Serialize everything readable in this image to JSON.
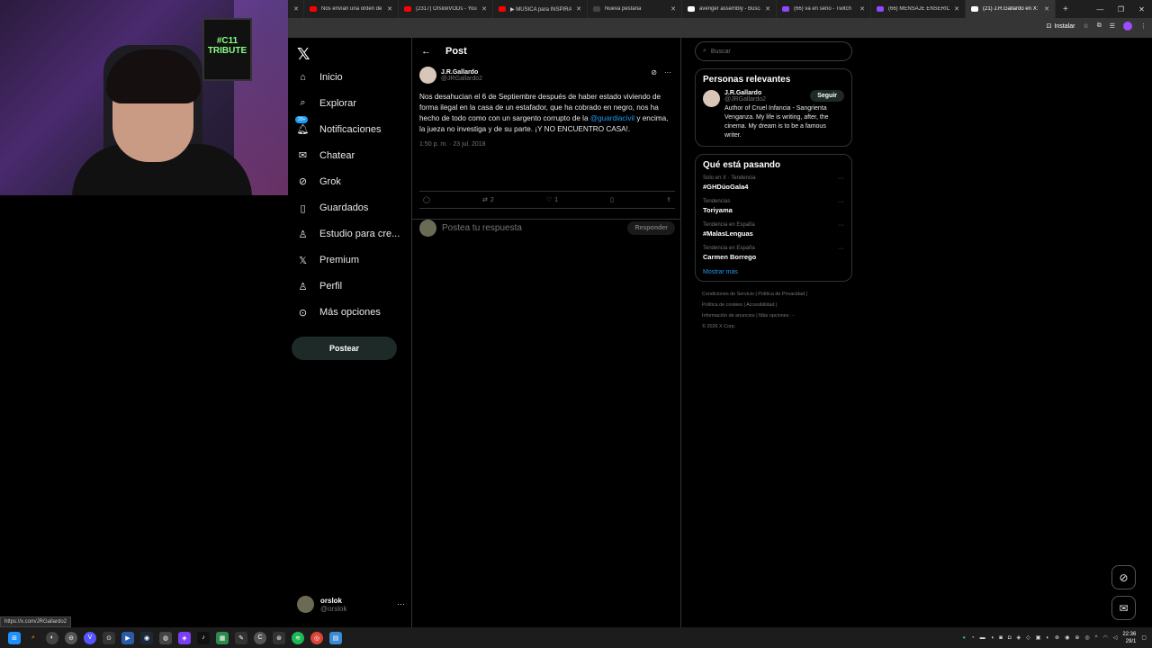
{
  "browser": {
    "tabs": [
      {
        "title": "Nos envían una orden de",
        "color": "#ff0000"
      },
      {
        "title": "(2317) OrslokVODs - YouT",
        "color": "#ff0000"
      },
      {
        "title": "▶ MÚSICA para INSPIRAR",
        "color": "#ff0000"
      },
      {
        "title": "Nueva pestaña",
        "color": "#444444"
      },
      {
        "title": "avenger assembly - Busca",
        "color": "#ffffff"
      },
      {
        "title": "(66) va en serio - Twitch",
        "color": "#9146ff"
      },
      {
        "title": "(66) MENSAJE ENSERIO -",
        "color": "#9146ff"
      },
      {
        "title": "(21) J.R.Gallardo en X: \"No",
        "color": "#ffffff"
      }
    ],
    "new_tab": "+",
    "install_label": "Instalar",
    "status_url": "https://x.com/JRGallardo2"
  },
  "webcam": {
    "poster_text": "#C11 TRIBUTE"
  },
  "nav": {
    "items": [
      {
        "label": "Inicio",
        "icon": "home-icon"
      },
      {
        "label": "Explorar",
        "icon": "search-icon"
      },
      {
        "label": "Notificaciones",
        "icon": "bell-icon",
        "badge": "20+"
      },
      {
        "label": "Chatear",
        "icon": "mail-icon"
      },
      {
        "label": "Grok",
        "icon": "grok-icon"
      },
      {
        "label": "Guardados",
        "icon": "bookmark-icon"
      },
      {
        "label": "Estudio para cre...",
        "icon": "studio-icon"
      },
      {
        "label": "Premium",
        "icon": "x-premium-icon"
      },
      {
        "label": "Perfil",
        "icon": "person-icon"
      },
      {
        "label": "Más opciones",
        "icon": "more-circle-icon"
      }
    ],
    "post_button": "Postear",
    "account": {
      "name": "orslok",
      "handle": "@orslok"
    }
  },
  "post": {
    "header_title": "Post",
    "author_name": "J.R.Gallardo",
    "author_handle": "@JRGallardo2",
    "text_before": "Nos desahucian el 6 de Septiembre después de haber estado viviendo de forma ilegal en la casa de un estafador, que ha cobrado en negro, nos ha hecho de todo como con un sargento corrupto de la ",
    "mention": "@guardiacivil",
    "text_after": " y encima, la jueza no investiga y de su parte. ¡Y NO ENCUENTRO CASA!.",
    "time": "1:50 p. m. · 23 jul. 2018",
    "retweets": "2",
    "likes": "1",
    "reply_placeholder": "Postea tu respuesta",
    "reply_button": "Responder"
  },
  "right": {
    "search_placeholder": "Buscar",
    "relevant_title": "Personas relevantes",
    "person": {
      "name": "J.R.Gallardo",
      "handle": "@JRGallardo2",
      "bio": "Author of Cruel Infancia - Sangrienta Venganza. My life is writing, after, the cinema. My dream is to be a famous writer.",
      "follow": "Seguir"
    },
    "trends_title": "Qué está pasando",
    "trends": [
      {
        "context": "Solo en X · Tendencia",
        "name": "#GHDúoGala4"
      },
      {
        "context": "Tendencias",
        "name": "Toriyama"
      },
      {
        "context": "Tendencia en España",
        "name": "#MalasLenguas"
      },
      {
        "context": "Tendencia en España",
        "name": "Carmen Borrego"
      }
    ],
    "show_more": "Mostrar más",
    "footer": {
      "l1a": "Condiciones de Servicio",
      "l1b": "Política de Privacidad",
      "l2a": "Política de cookies",
      "l2b": "Accesibilidad",
      "l3a": "Información de anuncios",
      "l3b": "Más opciones ···",
      "copyright": "© 2026 X Corp."
    }
  },
  "taskbar": {
    "time": "22:36",
    "date": "29/1"
  }
}
